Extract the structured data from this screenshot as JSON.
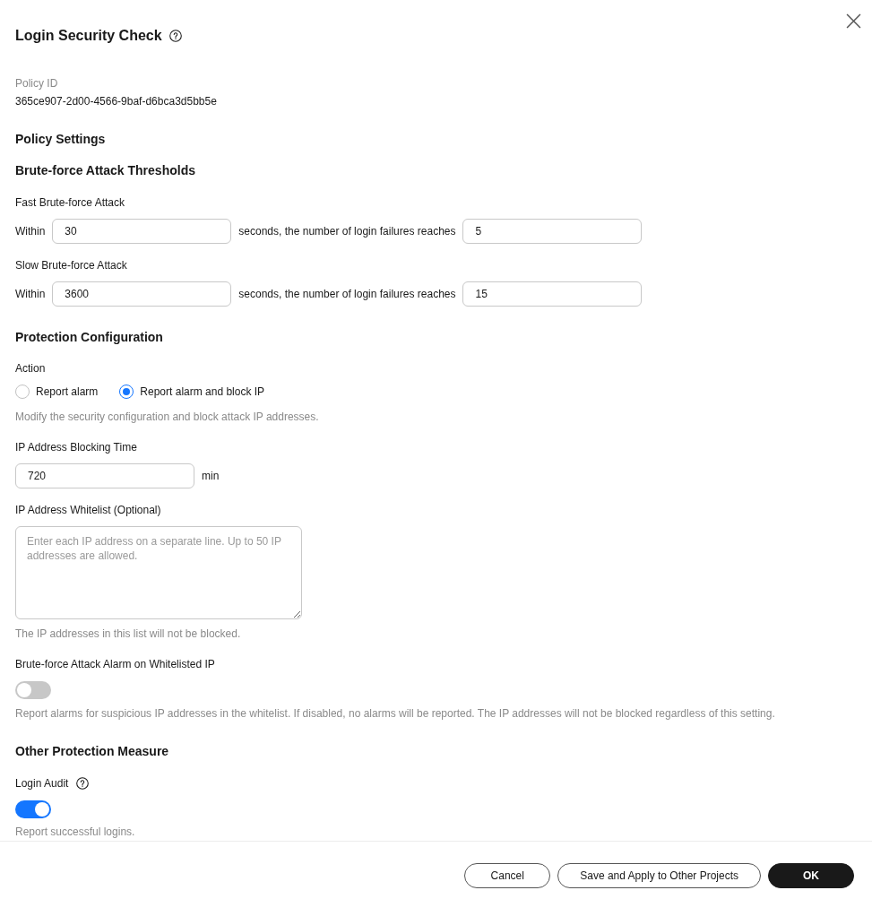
{
  "dialog": {
    "title": "Login Security Check"
  },
  "policy_id": {
    "label": "Policy ID",
    "value": "365ce907-2d00-4566-9baf-d6bca3d5bb5e"
  },
  "policy_settings": {
    "heading": "Policy Settings"
  },
  "brute_force_thresholds": {
    "heading": "Brute-force Attack Thresholds",
    "rules": [
      {
        "label": "Fast Brute-force Attack",
        "prefix": "Within",
        "seconds": "30",
        "middle": "seconds, the number of login failures reaches",
        "failures": "5"
      },
      {
        "label": "Slow Brute-force Attack",
        "prefix": "Within",
        "seconds": "3600",
        "middle": "seconds, the number of login failures reaches",
        "failures": "15"
      }
    ]
  },
  "protection_configuration": {
    "heading": "Protection Configuration",
    "action": {
      "label": "Action",
      "options": [
        {
          "label": "Report alarm",
          "selected": false
        },
        {
          "label": "Report alarm and block IP",
          "selected": true
        }
      ],
      "hint": "Modify the security configuration and block attack IP addresses."
    },
    "blocking_time": {
      "label": "IP Address Blocking Time",
      "value": "720",
      "unit": "min"
    },
    "whitelist": {
      "label": "IP Address Whitelist (Optional)",
      "placeholder": "Enter each IP address on a separate line. Up to 50 IP addresses are allowed.",
      "hint": "The IP addresses in this list will not be blocked."
    },
    "whitelist_alarm": {
      "label": "Brute-force Attack Alarm on Whitelisted IP",
      "on": false,
      "hint": "Report alarms for suspicious IP addresses in the whitelist. If disabled, no alarms will be reported. The IP addresses will not be blocked regardless of this setting."
    }
  },
  "other_protection": {
    "heading": "Other Protection Measure",
    "login_audit": {
      "label": "Login Audit",
      "on": true,
      "hint": "Report successful logins."
    }
  },
  "buttons": [
    {
      "label": "Cancel",
      "kind": "secondary"
    },
    {
      "label": "Save and Apply to Other Projects",
      "kind": "secondary"
    },
    {
      "label": "OK",
      "kind": "primary"
    }
  ]
}
